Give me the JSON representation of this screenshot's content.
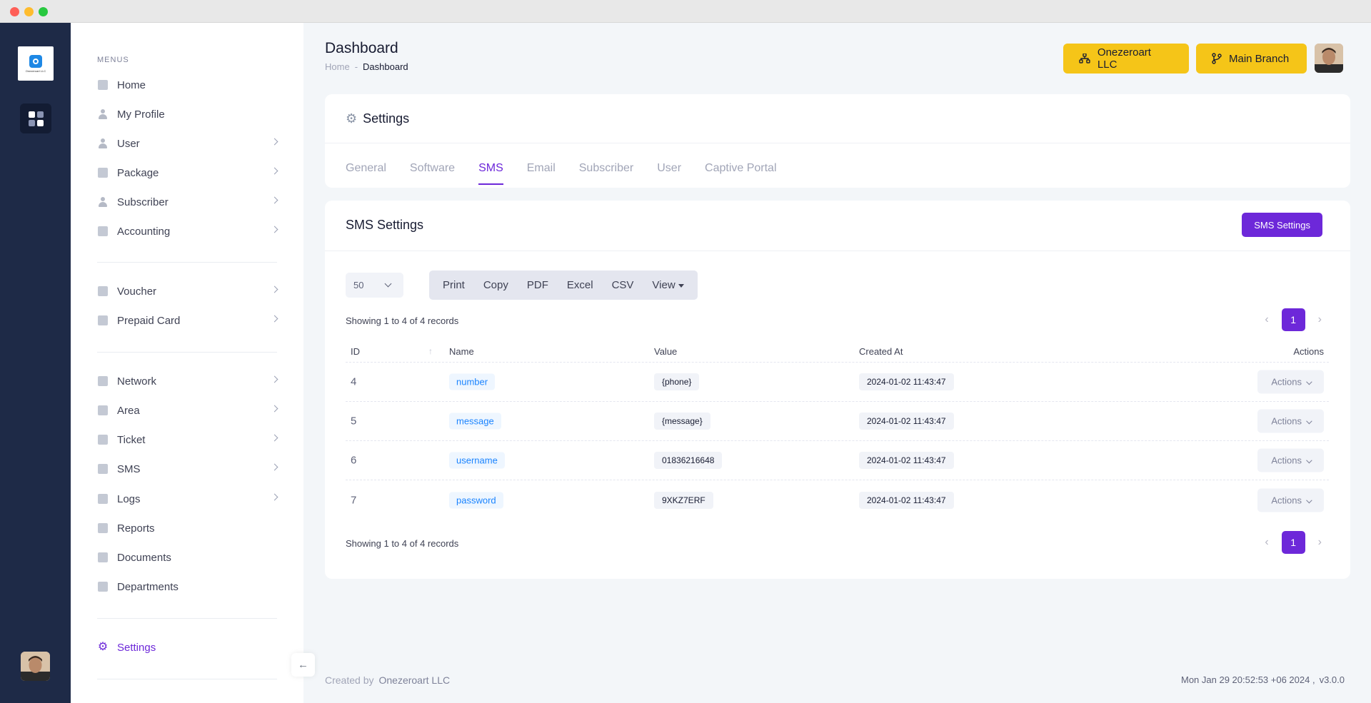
{
  "brand": {
    "name": "Onezeroart LLC"
  },
  "menu": {
    "heading": "MENUS",
    "items": [
      {
        "label": "Home"
      },
      {
        "label": "My Profile"
      },
      {
        "label": "User"
      },
      {
        "label": "Package"
      },
      {
        "label": "Subscriber"
      },
      {
        "label": "Accounting"
      },
      {
        "label": "Voucher"
      },
      {
        "label": "Prepaid Card"
      },
      {
        "label": "Network"
      },
      {
        "label": "Area"
      },
      {
        "label": "Ticket"
      },
      {
        "label": "SMS"
      },
      {
        "label": "Logs"
      },
      {
        "label": "Reports"
      },
      {
        "label": "Documents"
      },
      {
        "label": "Departments"
      },
      {
        "label": "Settings"
      }
    ]
  },
  "header": {
    "title": "Dashboard",
    "breadcrumb": {
      "home": "Home",
      "separator": "-",
      "current": "Dashboard"
    },
    "org_button": "Onezeroart LLC",
    "branch_button": "Main Branch"
  },
  "settings": {
    "title": "Settings",
    "tabs": [
      "General",
      "Software",
      "SMS",
      "Email",
      "Subscriber",
      "User",
      "Captive Portal"
    ],
    "active_tab": "SMS"
  },
  "sms": {
    "title": "SMS Settings",
    "button": "SMS Settings",
    "page_size": "50",
    "export": [
      "Print",
      "Copy",
      "PDF",
      "Excel",
      "CSV",
      "View"
    ],
    "showing": "Showing 1 to 4 of 4 records",
    "pagination": {
      "current": "1"
    },
    "columns": [
      "ID",
      "Name",
      "Value",
      "Created At",
      "Actions"
    ],
    "rows": [
      {
        "id": "4",
        "name": "number",
        "value": "{phone}",
        "created_at": "2024-01-02 11:43:47",
        "action": "Actions"
      },
      {
        "id": "5",
        "name": "message",
        "value": "{message}",
        "created_at": "2024-01-02 11:43:47",
        "action": "Actions"
      },
      {
        "id": "6",
        "name": "username",
        "value": "01836216648",
        "created_at": "2024-01-02 11:43:47",
        "action": "Actions"
      },
      {
        "id": "7",
        "name": "password",
        "value": "9XKZ7ERF",
        "created_at": "2024-01-02 11:43:47",
        "action": "Actions"
      }
    ]
  },
  "footer": {
    "created_by": "Created by",
    "company": "Onezeroart LLC",
    "timestamp": "Mon Jan 29 20:52:53 +06 2024 ,",
    "version": "v3.0.0"
  },
  "colors": {
    "accent": "#6d28d9",
    "header_button": "#f5c518",
    "rail": "#1e2a47"
  }
}
